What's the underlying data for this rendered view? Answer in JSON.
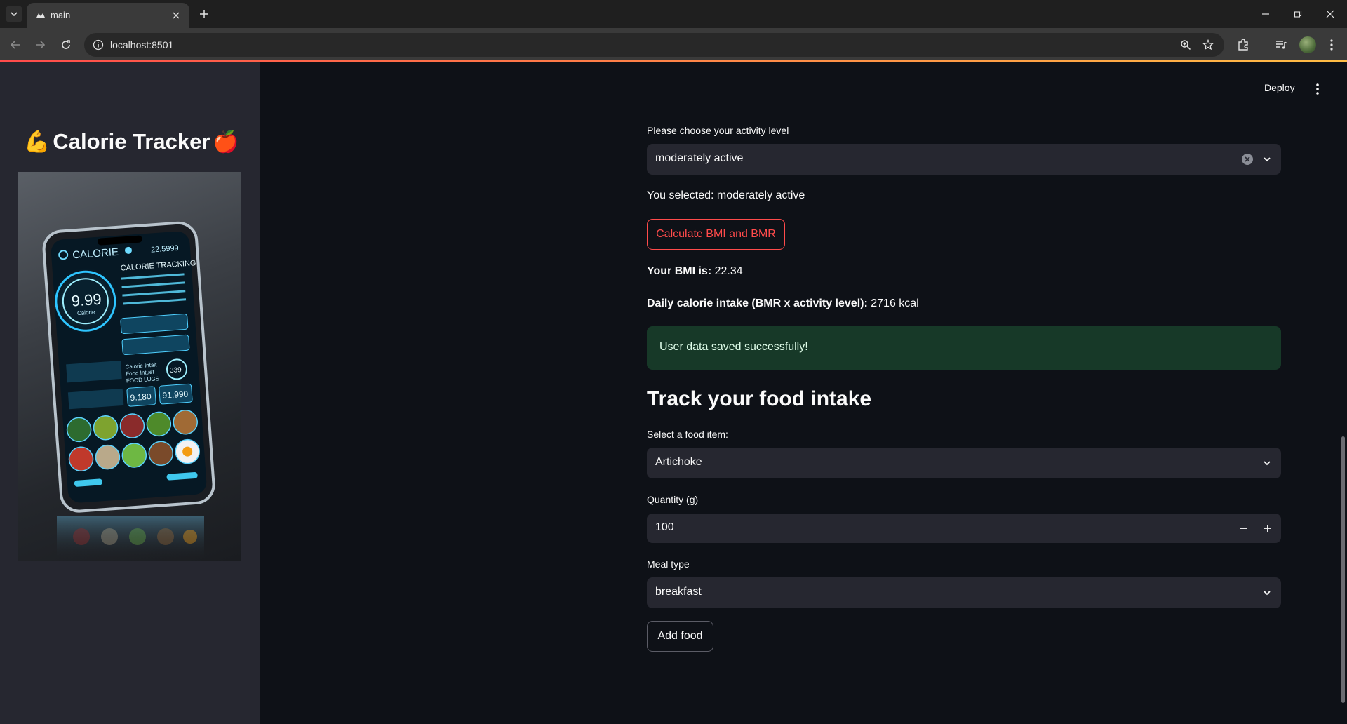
{
  "browser": {
    "tab_title": "main",
    "url": "localhost:8501"
  },
  "header": {
    "deploy_label": "Deploy"
  },
  "sidebar": {
    "title": "Calorie Tracker",
    "title_emoji_left": "💪",
    "title_emoji_right": "🍎",
    "hero_image": {
      "screen_title": "CALORIE",
      "screen_value_top": "22.5999",
      "tracking_label": "CALORIE TRACKING",
      "gauge_value": "9.99",
      "gauge_caption": "Calorie",
      "intake_lines": [
        "Calorie Intait",
        "Food Intuet",
        "FOOD LUGS"
      ],
      "badge_value": "339",
      "tile_values": [
        "9.180",
        "91.990"
      ]
    }
  },
  "activity": {
    "label": "Please choose your activity level",
    "selected": "moderately active",
    "you_selected": "You selected: moderately active"
  },
  "calc_button_label": "Calculate BMI and BMR",
  "bmi": {
    "label": "Your BMI is:",
    "value": "22.34"
  },
  "calories": {
    "label": "Daily calorie intake (BMR x activity level):",
    "value": "2716 kcal"
  },
  "alert": {
    "text": "User data saved successfully!"
  },
  "food_section": {
    "title": "Track your food intake",
    "food_label": "Select a food item:",
    "food_selected": "Artichoke",
    "quantity_label": "Quantity (g)",
    "quantity_value": "100",
    "meal_label": "Meal type",
    "meal_selected": "breakfast",
    "add_button_label": "Add food"
  },
  "colors": {
    "primary": "#ff4b4b",
    "background": "#0e1117",
    "sidebar": "#262730",
    "success_bg": "#173928"
  }
}
